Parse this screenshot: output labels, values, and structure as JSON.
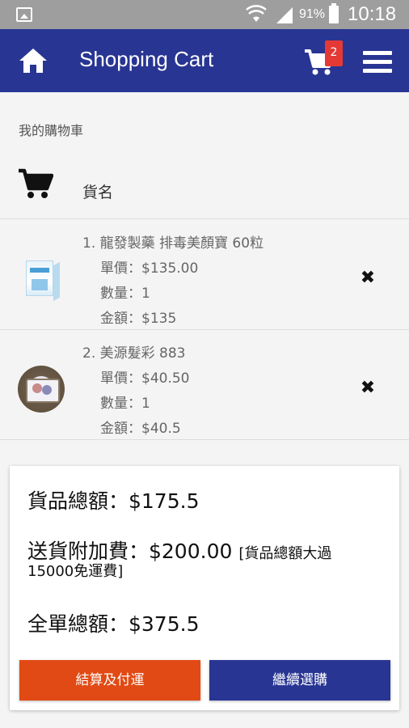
{
  "status_bar": {
    "battery": "91%",
    "time": "10:18"
  },
  "app_bar": {
    "title": "Shopping Cart",
    "cart_count": "2"
  },
  "section_label": "我的購物車",
  "list_header": {
    "column_name": "貨名"
  },
  "items": [
    {
      "name": "1. 龍發製藥 排毒美顏寶 60粒",
      "unit_price": "單價：$135.00",
      "quantity": "數量：1",
      "amount": "金額：$135",
      "remove": "✖"
    },
    {
      "name": "2. 美源髮彩 883",
      "unit_price": "單價：$40.50",
      "quantity": "數量：1",
      "amount": "金額：$40.5",
      "remove": "✖"
    }
  ],
  "summary": {
    "goods_total": "貨品總額：$175.5",
    "shipping_fee": "送貨附加費：$200.00",
    "shipping_note_1": "[貨品總額大過",
    "shipping_note_2": "15000免運費]",
    "order_total": "全單總額：$375.5",
    "checkout_button": "結算及付運",
    "continue_button": "繼續選購"
  },
  "colors": {
    "app_bar": "#283593",
    "status_bar": "#9e9e9e",
    "checkout_button": "#e14a14",
    "continue_button": "#283593",
    "badge": "#e53935"
  },
  "icons": [
    "image-icon",
    "wifi-icon",
    "signal-icon",
    "battery-icon",
    "home-icon",
    "cart-icon",
    "menu-icon",
    "remove-icon"
  ]
}
